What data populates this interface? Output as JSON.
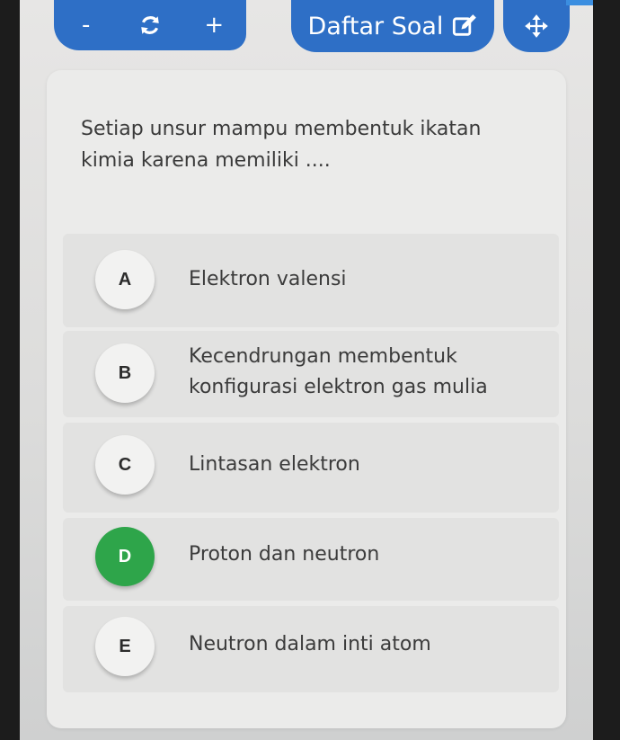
{
  "toolbar": {
    "minus_label": "-",
    "refresh_icon": "refresh-icon",
    "plus_label": "+",
    "daftar_label": "Daftar Soal",
    "edit_icon": "edit-icon",
    "move_icon": "move-icon",
    "accent_color": "#2e6fc6"
  },
  "question": {
    "text": "Setiap unsur mampu membentuk ikatan kimia karena memiliki ...."
  },
  "options": [
    {
      "letter": "A",
      "text": "Elektron valensi",
      "selected": false
    },
    {
      "letter": "B",
      "text": "Kecendrungan membentuk konfigurasi elektron gas mulia",
      "selected": false
    },
    {
      "letter": "C",
      "text": "Lintasan elektron",
      "selected": false
    },
    {
      "letter": "D",
      "text": "Proton dan neutron",
      "selected": true
    },
    {
      "letter": "E",
      "text": "Neutron dalam inti atom",
      "selected": false
    }
  ],
  "selected_color": "#2ea54a"
}
